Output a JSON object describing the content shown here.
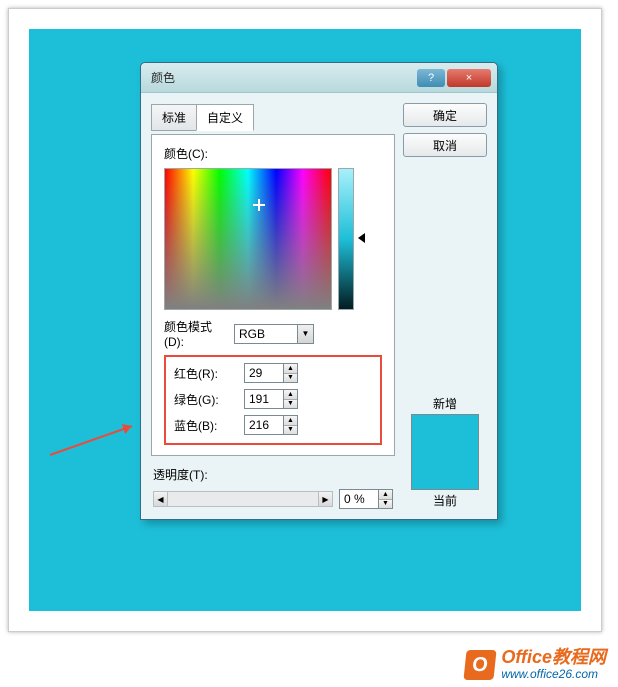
{
  "dialog": {
    "title": "颜色",
    "help_glyph": "?",
    "close_glyph": "×",
    "ok_label": "确定",
    "cancel_label": "取消",
    "tabs": {
      "standard": "标准",
      "custom": "自定义"
    },
    "color_label": "颜色(C):",
    "mode_label": "颜色模式(D):",
    "mode_value": "RGB",
    "rgb": {
      "r_label": "红色(R):",
      "g_label": "绿色(G):",
      "b_label": "蓝色(B):",
      "r": "29",
      "g": "191",
      "b": "216"
    },
    "transparency_label": "透明度(T):",
    "transparency_value": "0 %",
    "preview": {
      "new_label": "新增",
      "current_label": "当前"
    }
  },
  "watermark": {
    "icon_glyph": "O",
    "title": "Office教程网",
    "url": "www.office26.com"
  },
  "colors": {
    "accent": "#1dbfd8",
    "highlight_box": "#e74c3c",
    "brand_orange": "#e86a1e",
    "brand_blue": "#0066aa"
  }
}
